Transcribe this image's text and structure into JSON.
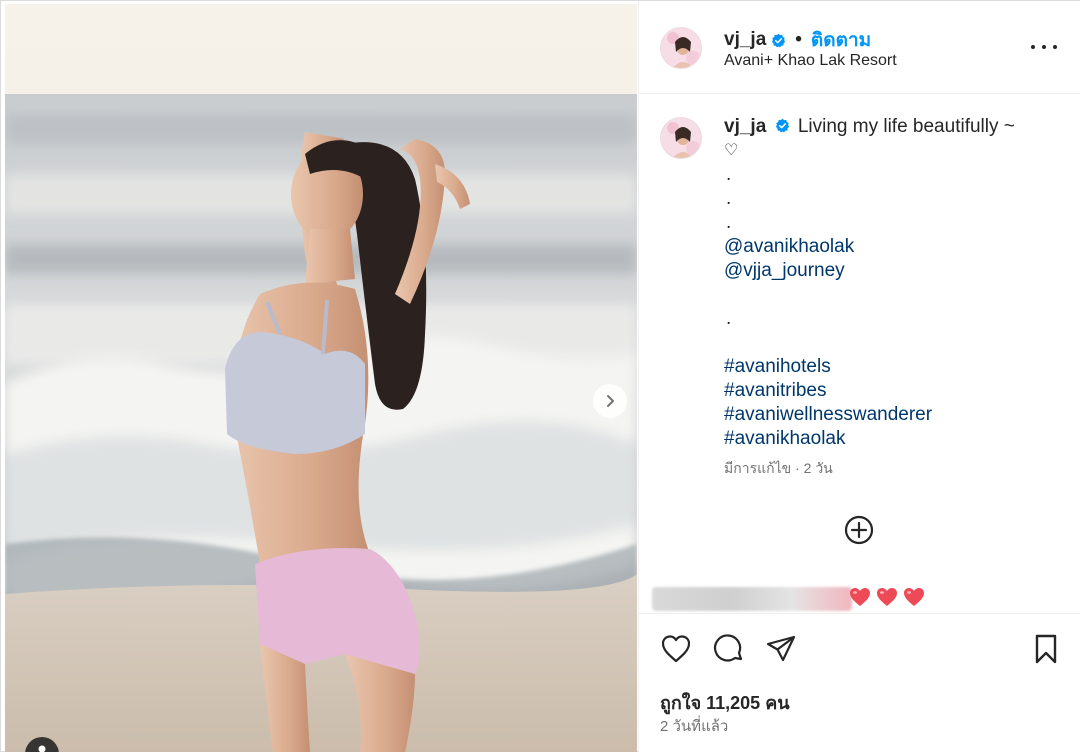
{
  "post": {
    "username": "vj_ja",
    "separator": "•",
    "follow_label": "ติดตาม",
    "location": "Avani+ Khao Lak Resort",
    "more_icon": "more-horizontal-icon"
  },
  "caption": {
    "username": "vj_ja",
    "first_line": "Living my life beautifully ~",
    "heart_symbol": "♡",
    "lines": [
      {
        "kind": "dot",
        "text": "."
      },
      {
        "kind": "dot",
        "text": "."
      },
      {
        "kind": "dot",
        "text": "."
      },
      {
        "kind": "mention",
        "text": "@avanikhaolak"
      },
      {
        "kind": "mention",
        "text": "@vjja_journey"
      },
      {
        "kind": "blank",
        "text": ""
      },
      {
        "kind": "dot",
        "text": "."
      },
      {
        "kind": "blank",
        "text": ""
      },
      {
        "kind": "tag",
        "text": "#avanihotels"
      },
      {
        "kind": "tag",
        "text": "#avanitribes"
      },
      {
        "kind": "tag",
        "text": "#avaniwellnesswanderer"
      },
      {
        "kind": "tag",
        "text": "#avanikhaolak"
      }
    ],
    "meta": "มีการแก้ไข · 2 วัน"
  },
  "comment_preview": {
    "hearts": [
      "❤",
      "❤",
      "❤"
    ],
    "heart_color": "#ed4956"
  },
  "stats": {
    "likes_text": "ถูกใจ 11,205 คน",
    "time_ago": "2 วันที่แล้ว"
  },
  "colors": {
    "accent_blue": "#0095f6",
    "link_dark_blue": "#00376b",
    "text_primary": "#262626",
    "text_secondary": "#737373"
  }
}
